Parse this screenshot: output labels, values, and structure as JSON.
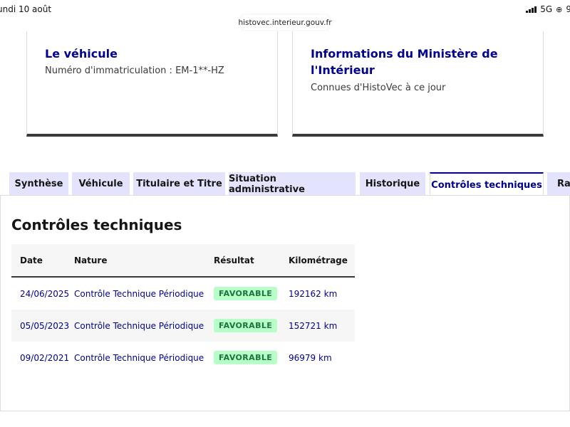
{
  "status_bar": {
    "time": "undi 10 août",
    "network": "5G",
    "battery": "9"
  },
  "browser": {
    "url": "histovec.interieur.gouv.fr"
  },
  "cards": [
    {
      "title": "Le véhicule",
      "text": "Numéro d'immatriculation : EM-1**-HZ"
    },
    {
      "title": "Informations du Ministère de l'Intérieur",
      "text": "Connues d'HistoVec à ce jour"
    }
  ],
  "tabs": [
    {
      "label": "Synthèse"
    },
    {
      "label": "Véhicule"
    },
    {
      "label": "Titulaire et Titre"
    },
    {
      "label": "Situation administrative"
    },
    {
      "label": "Historique"
    },
    {
      "label": "Contrôles techniques",
      "active": true
    },
    {
      "label": "Rap"
    }
  ],
  "section": {
    "title": "Contrôles techniques"
  },
  "table": {
    "headers": [
      "Date",
      "Nature",
      "Résultat",
      "Kilométrage"
    ],
    "rows": [
      {
        "date": "24/06/2025",
        "nature": "Contrôle Technique Périodique",
        "result": "FAVORABLE",
        "km": "192162 km"
      },
      {
        "date": "05/05/2023",
        "nature": "Contrôle Technique Périodique",
        "result": "FAVORABLE",
        "km": "152721 km"
      },
      {
        "date": "09/02/2021",
        "nature": "Contrôle Technique Périodique",
        "result": "FAVORABLE",
        "km": "96979 km"
      }
    ]
  },
  "colors": {
    "primary": "#000091",
    "tab_background": "#e3e3fd",
    "badge_background": "#b8fec9",
    "badge_text": "#18753c"
  }
}
